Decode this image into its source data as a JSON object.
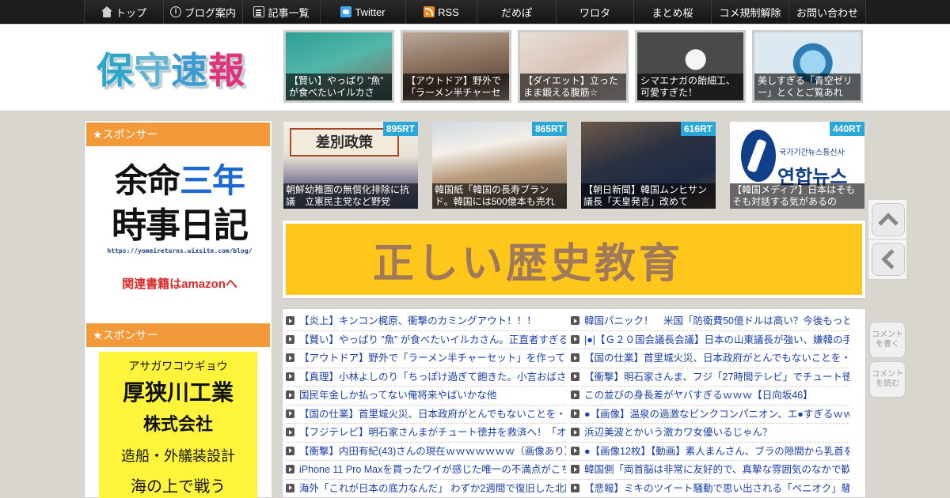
{
  "nav": {
    "items": [
      {
        "label": "トップ",
        "icon": "home-icon"
      },
      {
        "label": "ブログ案内",
        "icon": "info-icon"
      },
      {
        "label": "記事一覧",
        "icon": "list-icon"
      },
      {
        "label": "Twitter",
        "icon": "twitter-icon"
      },
      {
        "label": "RSS",
        "icon": "rss-icon"
      },
      {
        "label": "だめぽ",
        "icon": ""
      },
      {
        "label": "ワロタ",
        "icon": ""
      },
      {
        "label": "まとめ桜",
        "icon": ""
      },
      {
        "label": "コメ規制解除",
        "icon": ""
      },
      {
        "label": "お問い合わせ",
        "icon": ""
      }
    ]
  },
  "logo": {
    "c1": "保",
    "c2": "守",
    "c3": "速",
    "c4": "報"
  },
  "header_thumbs": [
    {
      "caption": "【賢い】やっぱり ”魚” が食べたいイルカさん。"
    },
    {
      "caption": "【アウトドア】野外で「ラーメン半チャーセット」"
    },
    {
      "caption": "【ダイエット】立ったまま鍛える腹筋☆"
    },
    {
      "caption": "シマエナガの飴細工、可愛すぎた！"
    },
    {
      "caption": "美しすぎる「青空ゼリー」とくとご覧あれ"
    }
  ],
  "sidebar": {
    "sponsor1": "★スポンサー",
    "ad1": {
      "line1_a": "余命",
      "line1_b": "三年",
      "line2": "時事日記",
      "url": "https://yomeireturns.wixsite.com/blog/",
      "amazon": "関連書籍はamazonへ"
    },
    "sponsor2": "★スポンサー",
    "ad2": {
      "kana": "アサガワコウギョウ",
      "name": "厚狭川工業",
      "kk": "株式会社",
      "service": "造船・外艤装設計",
      "more": "海の上で戦う"
    }
  },
  "ranking": [
    {
      "rt": "895RT",
      "banner": "差別政策",
      "caption": "朝鮮幼稚園の無償化排除に抗議　立憲民主党など野党"
    },
    {
      "rt": "865RT",
      "caption": "韓国紙「韓国の長寿ブランド。韓国には500億本も売れ"
    },
    {
      "rt": "616RT",
      "caption": "【朝日新聞】韓国ムンヒサン議長「天皇発言」改めて"
    },
    {
      "rt": "440RT",
      "kor_small": "국가기간뉴스통신사",
      "kor": "연합뉴스",
      "caption": "【韓国メディア】日本はそもそも対話する気があるの"
    }
  ],
  "banner": {
    "text": "正しい歴史教育"
  },
  "side_buttons": {
    "comment_write": "コメントを書く",
    "comment_read": "コメントを読む"
  },
  "articles": {
    "left": [
      "【炎上】キンコン梶原、衝撃のカミングアウト！！！",
      "【賢い】やっぱり ”魚” が食べたいイルカさん。正直者すぎる！",
      "【アウトドア】野外で「ラーメン半チャーセット」を作って食",
      "【真理】小林よしのり「ちっぽけ過ぎて飽きた。小言おばさんに",
      "国民年金しか払ってない俺将来やばいかな他",
      "【国の仕業】首里城火災、日本政府がとんでもないことを・・",
      "【フジテレビ】明石家さんまがチュート徳井を救済へ！「オレ",
      "【衝撃】内田有紀(43)さんの現在ｗｗｗｗｗｗｗ（画像あり）",
      "iPhone 11 Pro Maxを買ったワイが感じた唯一の不満点がこちら",
      "海外「これが日本の底力なんだ」 わずか2週間で復旧した北陸"
    ],
    "right": [
      "韓国パニック！　米国「防衛費50億ドルは高い？今後もっと上",
      "|●|【Ｇ２０国会議長会議】日本の山東議長が強い、嫌韓の手本",
      "【国の仕業】首里城火災、日本政府がとんでもないことを・・",
      "【衝撃】明石家さんま、フジ「27時間テレビ」でチュート徳井",
      "この並びの身長差がヤバすぎるｗｗｗ【日向坂46】",
      "●【画像】温泉の過激なピンクコンパニオン、エ●すぎるｗｗｗ",
      "浜辺美波とかいう激カワ女優いるじゃん？",
      "●【画像12枚】【動画】素人まんさん、ブラの隙間から乳首を披",
      "韓国側「両首脳は非常に友好的で、真摯な雰囲気のなかで歓談",
      "【悲報】ミキのツイート騒動で思い出される「ペニオク」騒動"
    ]
  },
  "colors": {
    "nav_bg": "#1e1e1e",
    "sponsor_header": "#f29a3a",
    "rt_badge": "#2aa8d8",
    "link": "#1a3fa8",
    "banner_bg": "#ffc61c"
  }
}
